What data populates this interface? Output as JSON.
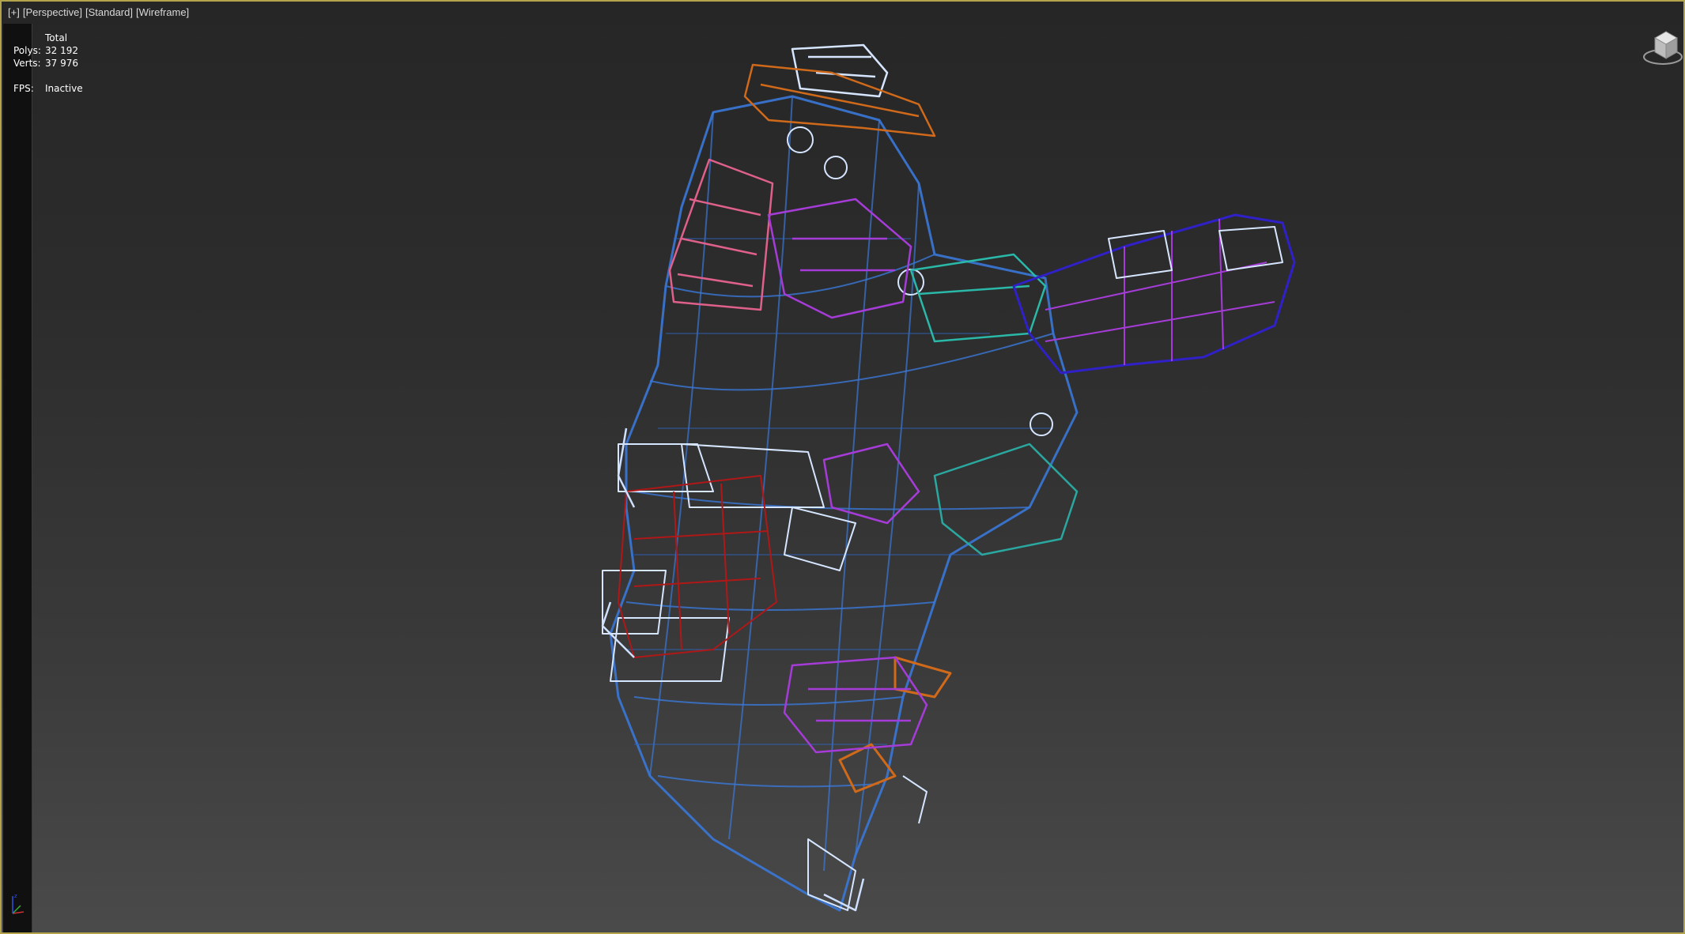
{
  "viewport": {
    "label_parts": [
      "[+]",
      "[Perspective]",
      "[Standard]",
      "[Wireframe]"
    ]
  },
  "stats": {
    "header": "Total",
    "polys_label": "Polys:",
    "polys_value": "32 192",
    "verts_label": "Verts:",
    "verts_value": "37 976",
    "fps_label": "FPS:",
    "fps_value": "Inactive"
  },
  "icons": {
    "viewcube": "viewcube-icon",
    "axis": "axis-tripod-icon"
  },
  "colors": {
    "viewport_border": "#b3a34a",
    "wire_blue": "#3a78d8",
    "wire_light": "#d6e6ff",
    "wire_pink": "#e0608c",
    "wire_orange": "#d06a1a",
    "wire_purple": "#a63cd8",
    "wire_teal": "#2ab8a8",
    "wire_red": "#b01818",
    "wire_navy": "#3020c8"
  }
}
